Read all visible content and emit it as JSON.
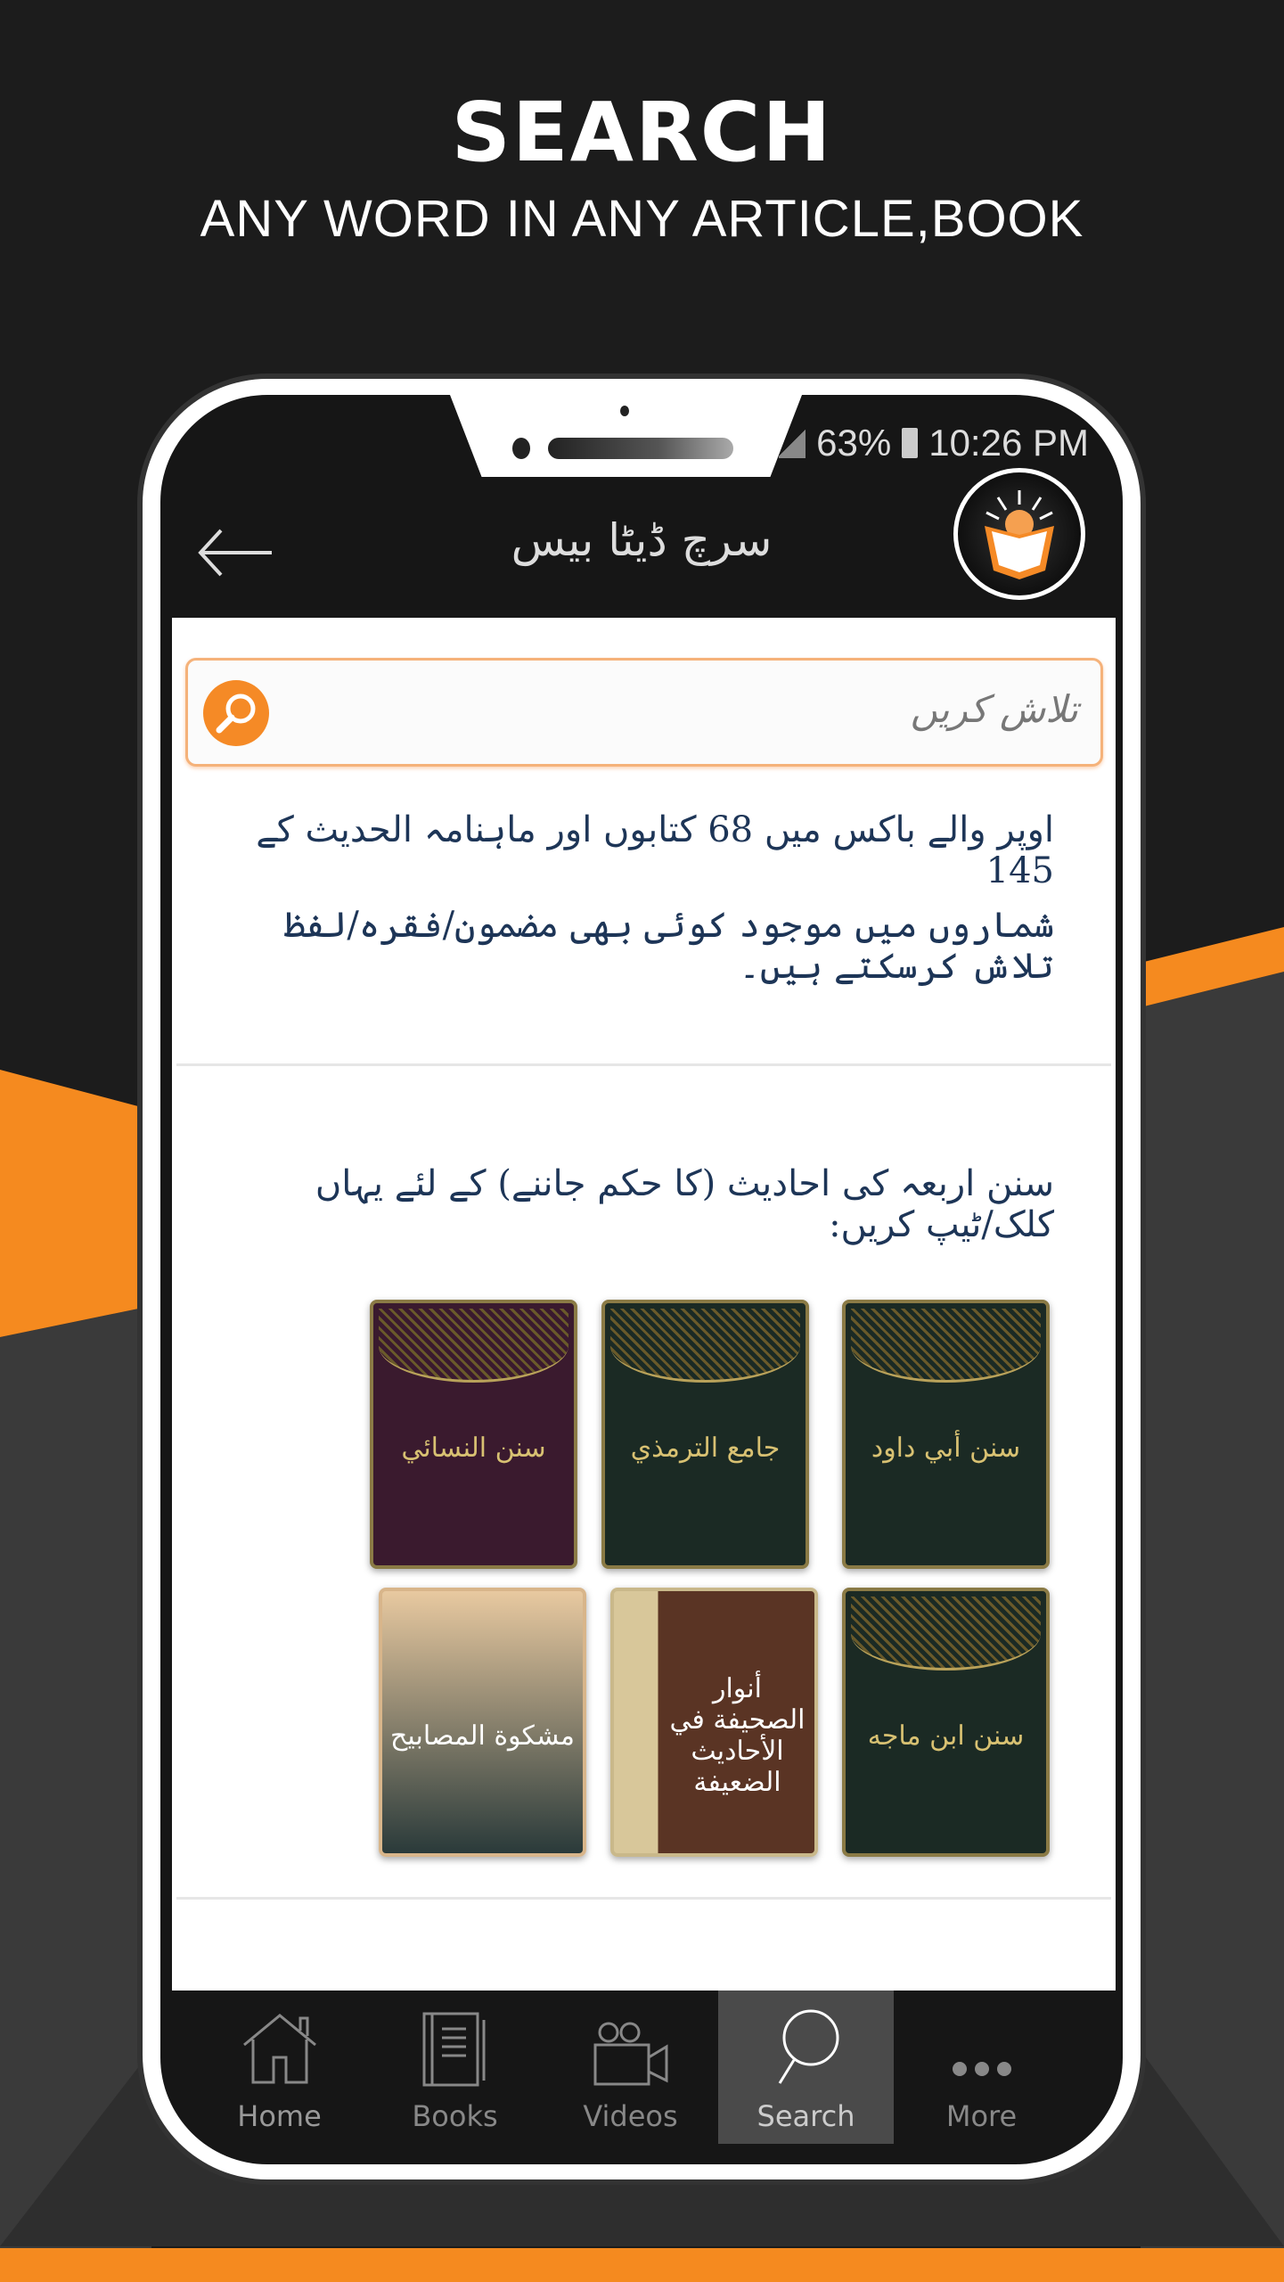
{
  "promo": {
    "title": "SEARCH",
    "subtitle": "ANY WORD IN ANY ARTICLE,BOOK"
  },
  "status": {
    "battery": "63%",
    "time": "10:26 PM"
  },
  "appbar": {
    "title": "سرچ ڈیٹا بیس"
  },
  "search": {
    "placeholder": "تلاش کریں",
    "value": ""
  },
  "intro": {
    "line1": "اوپر والے باکس میں  68  کتابوں اور ماہنامہ الحدیث کے  145",
    "line2": "شماروں میں موجود کوئی بھی مضمون/فقرہ/لفظ تلاش کرسکتے ہیں۔"
  },
  "sunan_heading": "سنن اربعہ کی احادیث (کا حکم جاننے) کے لئے یہاں کلک/ٹیپ کریں:",
  "books": [
    {
      "title": "سنن النسائي",
      "color": "#3a1a2e"
    },
    {
      "title": "جامع الترمذي",
      "color": "#1b2a24"
    },
    {
      "title": "سنن أبي داود",
      "color": "#1b2a24"
    },
    {
      "title": "مشكوة المصابيح",
      "color": "#d8b58a"
    },
    {
      "title": "أنوار الصحيفة في الأحاديث الضعيفة",
      "color": "#5a3424"
    },
    {
      "title": "سنن ابن ماجه",
      "color": "#1b2a24"
    }
  ],
  "nav": [
    {
      "label": "Home",
      "icon": "home-icon"
    },
    {
      "label": "Books",
      "icon": "book-icon"
    },
    {
      "label": "Videos",
      "icon": "video-camera-icon"
    },
    {
      "label": "Search",
      "icon": "search-icon",
      "active": true
    },
    {
      "label": "More",
      "icon": "more-dots-icon"
    }
  ],
  "colors": {
    "accent": "#f58a26",
    "text": "#1d3557",
    "bar": "#161616"
  }
}
